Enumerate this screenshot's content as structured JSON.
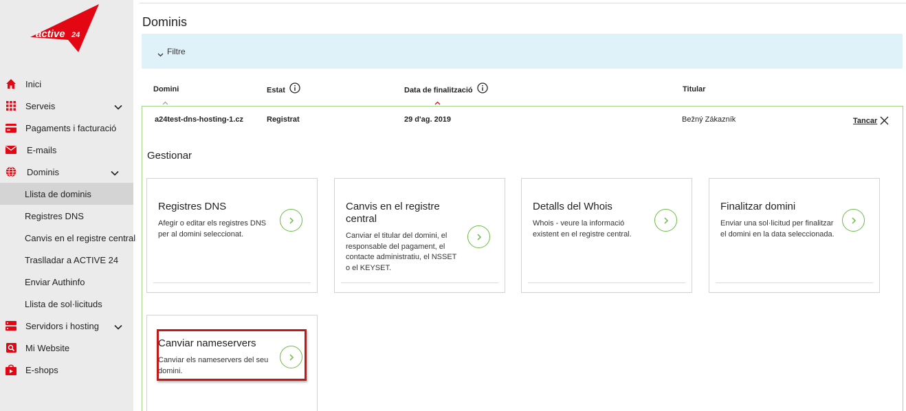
{
  "brand": {
    "logo_text": "active 24",
    "accent": "#e30613",
    "green": "#6dbb44"
  },
  "sidebar": {
    "items": [
      {
        "label": "Inici",
        "icon": "home-icon"
      },
      {
        "label": "Serveis",
        "icon": "grid-icon"
      },
      {
        "label": "Pagaments i facturació",
        "icon": "credit-card-icon"
      },
      {
        "label": "E-mails",
        "icon": "envelope-icon"
      },
      {
        "label": "Dominis",
        "icon": "globe-icon"
      },
      {
        "label": "Servidors i hosting",
        "icon": "server-icon"
      },
      {
        "label": "Mi Website",
        "icon": "website-icon"
      },
      {
        "label": "E-shops",
        "icon": "shop-icon"
      }
    ],
    "subitems": [
      "Llista de dominis",
      "Registres DNS",
      "Canvis en el registre central",
      "Traslladar a ACTIVE 24",
      "Enviar Authinfo",
      "Llista de sol·licituds"
    ]
  },
  "main": {
    "title": "Dominis",
    "filter_label": "Filtre",
    "columns": [
      "Domini",
      "Estat",
      "Data de finalització",
      "Titular"
    ],
    "row": {
      "domain": "a24test-dns-hosting-1.cz",
      "status": "Registrat",
      "end_date": "29 d'ag. 2019",
      "holder": "Bežný Zákazník",
      "close_label": "Tancar"
    },
    "manage_title": "Gestionar",
    "cards": [
      {
        "title": "Registres DNS",
        "desc": "Afegir o editar els registres DNS per al domini seleccionat."
      },
      {
        "title": "Canvis en el registre central",
        "desc": "Canviar el titular del domini, el responsable del pagament, el contacte administratiu, el NSSET o el KEYSET."
      },
      {
        "title": "Detalls del Whois",
        "desc": "Whois - veure la informació existent en el registre central."
      },
      {
        "title": "Finalitzar domini",
        "desc": "Enviar una sol·licitud per finalitzar el domini en la data seleccionada."
      },
      {
        "title": "Canviar nameservers",
        "desc": "Canviar els nameservers del seu domini."
      }
    ]
  }
}
